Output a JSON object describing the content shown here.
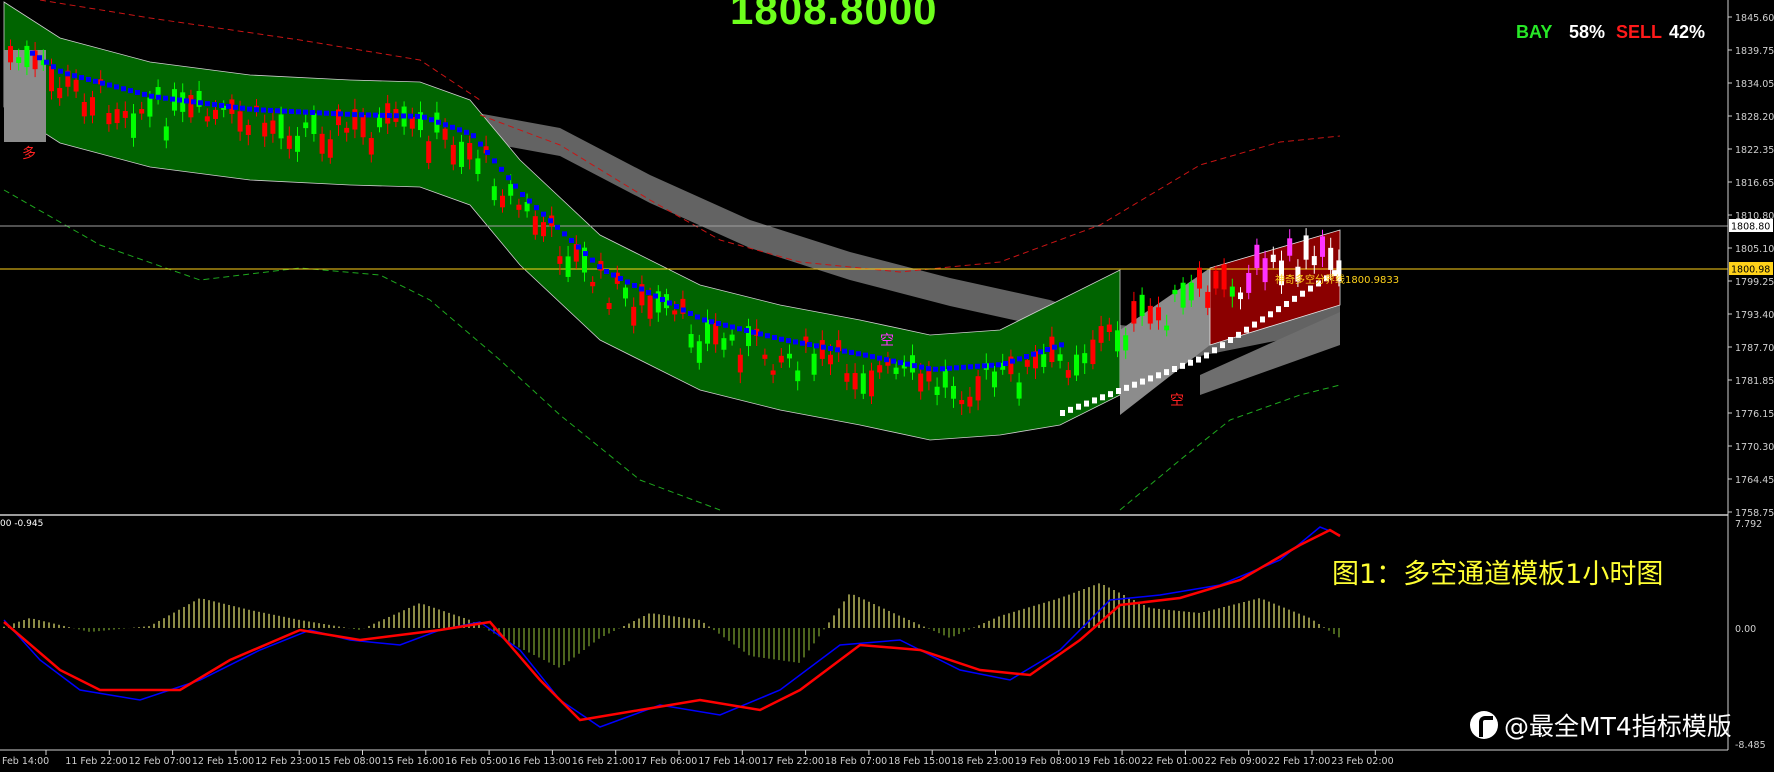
{
  "header": {
    "current_price": "1808.8000",
    "bay_label": "BAY",
    "bay_pct": "58%",
    "sell_label": "SELL",
    "sell_pct": "42%"
  },
  "price_axis": {
    "ticks": [
      "1845.60",
      "1839.75",
      "1834.05",
      "1828.20",
      "1822.35",
      "1816.65",
      "1810.80",
      "1805.10",
      "1799.25",
      "1793.40",
      "1787.70",
      "1781.85",
      "1776.15",
      "1770.30",
      "1764.45",
      "1758.75"
    ],
    "current_price_label": "1808.80",
    "level_label": "1800.98"
  },
  "channel_label": "神奇多空分界线1800.9833",
  "chinese_marks": {
    "duo": "多",
    "kong": "空"
  },
  "indicator": {
    "header": "00 -0.945",
    "ticks": [
      "7.792",
      "0.00",
      "-8.485"
    ]
  },
  "time_axis": [
    "Feb 14:00",
    "11 Feb 22:00",
    "12 Feb 07:00",
    "12 Feb 15:00",
    "12 Feb 23:00",
    "15 Feb 08:00",
    "15 Feb 16:00",
    "16 Feb 05:00",
    "16 Feb 13:00",
    "16 Feb 21:00",
    "17 Feb 06:00",
    "17 Feb 14:00",
    "17 Feb 22:00",
    "18 Feb 07:00",
    "18 Feb 15:00",
    "18 Feb 23:00",
    "19 Feb 08:00",
    "19 Feb 16:00",
    "22 Feb 01:00",
    "22 Feb 09:00",
    "22 Feb 17:00",
    "23 Feb 02:00"
  ],
  "caption": "图1：多空通道模板1小时图",
  "watermark": "@最全MT4指标模版",
  "colors": {
    "bull": "#00ff00",
    "bear": "#ff0000",
    "channel_green": "#006400",
    "channel_red": "#8b0000",
    "channel_gray": "#8c8c8c",
    "band_gray": "#6e6e6e",
    "trail_blue": "#0000ff",
    "trail_white": "#ffffff",
    "level": "#ffd21a",
    "macd_signal": "#ff0000",
    "macd_line": "#0000ff",
    "hist": "#c8c864"
  }
}
